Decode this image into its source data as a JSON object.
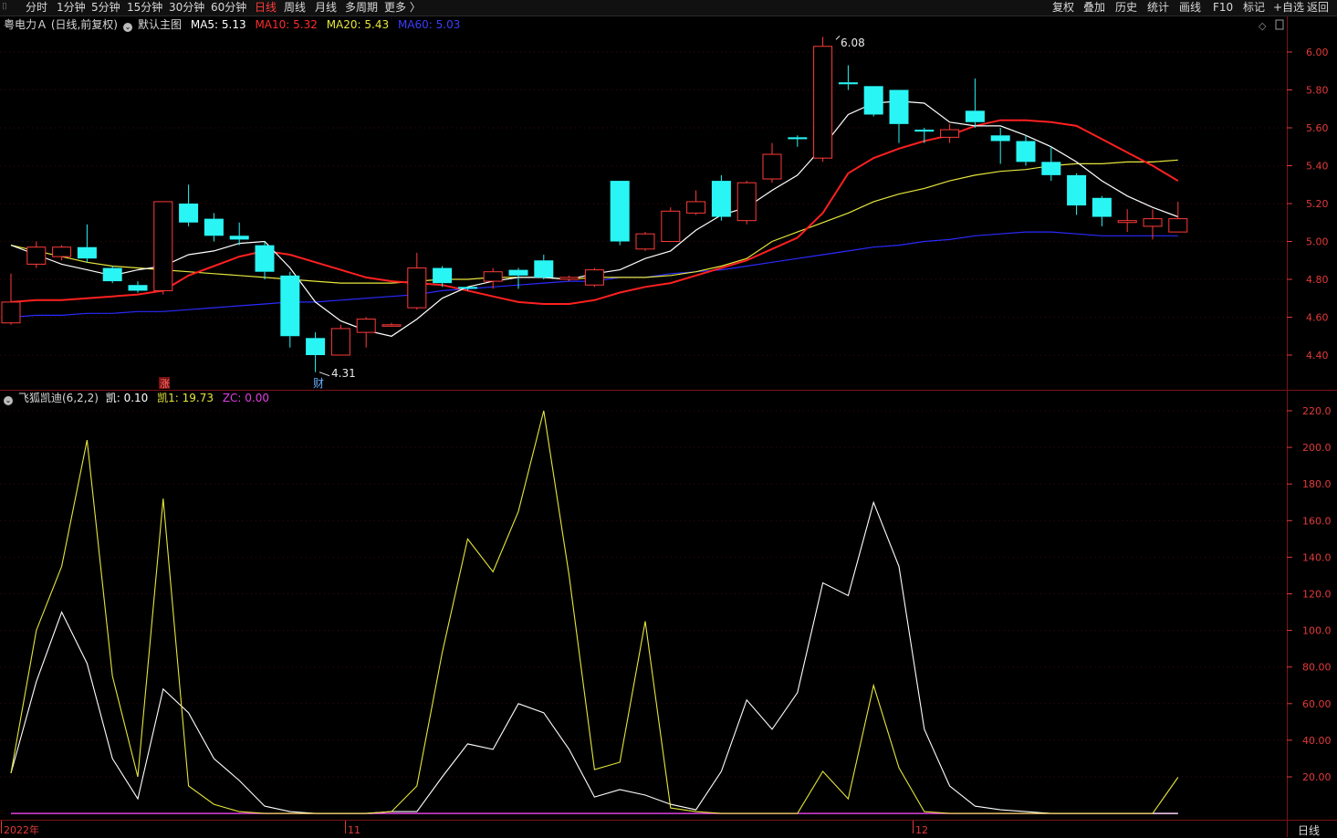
{
  "toolbar": {
    "left": [
      {
        "label": "分时",
        "active": false
      },
      {
        "label": "1分钟",
        "active": false
      },
      {
        "label": "5分钟",
        "active": false
      },
      {
        "label": "15分钟",
        "active": false
      },
      {
        "label": "30分钟",
        "active": false
      },
      {
        "label": "60分钟",
        "active": false
      },
      {
        "label": "日线",
        "active": true
      },
      {
        "label": "周线",
        "active": false
      },
      {
        "label": "月线",
        "active": false
      },
      {
        "label": "多周期",
        "active": false
      },
      {
        "label": "更多 〉",
        "active": false
      }
    ],
    "right": [
      "复权",
      "叠加",
      "历史",
      "统计",
      "画线",
      "F10",
      "标记",
      "+自选",
      "返回"
    ]
  },
  "main_legend": {
    "title": "粤电力Ａ (日线,前复权)",
    "template": "默认主图",
    "ma5": "MA5: 5.13",
    "ma10": "MA10: 5.32",
    "ma20": "MA20: 5.43",
    "ma60": "MA60: 5.03",
    "colors": {
      "ma5": "#ffffff",
      "ma10": "#ff2d2d",
      "ma20": "#e6e63c",
      "ma60": "#3232ff"
    }
  },
  "sub_legend": {
    "title": "飞狐凯迪(6,2,2)",
    "k": "凯: 0.10",
    "k1": "凯1: 19.73",
    "zc": "ZC: 0.00",
    "colors": {
      "k": "#ffffff",
      "k1": "#e6e63c",
      "zc": "#e040e0"
    }
  },
  "annotations": {
    "high": "6.08",
    "low": "4.31",
    "zhang": "涨",
    "cai": "财"
  },
  "x_labels": [
    "2022年",
    "11",
    "12"
  ],
  "footer_label": "日线",
  "chart_data": [
    {
      "type": "candlestick",
      "ylim": [
        4.23,
        6.18
      ],
      "yticks": [
        "6.00",
        "5.80",
        "5.60",
        "5.40",
        "5.20",
        "5.00",
        "4.80",
        "4.60",
        "4.40"
      ],
      "candles": [
        [
          4.57,
          4.68,
          4.56,
          4.83
        ],
        [
          4.88,
          4.97,
          4.86,
          5.0
        ],
        [
          4.92,
          4.97,
          4.9,
          4.98
        ],
        [
          4.97,
          4.91,
          4.89,
          5.09
        ],
        [
          4.86,
          4.79,
          4.78,
          4.87
        ],
        [
          4.77,
          4.74,
          4.73,
          4.79
        ],
        [
          4.74,
          5.21,
          4.72,
          5.21
        ],
        [
          5.2,
          5.1,
          5.08,
          5.3
        ],
        [
          5.12,
          5.03,
          5.0,
          5.15
        ],
        [
          5.03,
          5.01,
          4.98,
          5.1
        ],
        [
          4.98,
          4.84,
          4.8,
          5.0
        ],
        [
          4.82,
          4.5,
          4.44,
          4.84
        ],
        [
          4.49,
          4.4,
          4.31,
          4.52
        ],
        [
          4.4,
          4.54,
          4.4,
          4.56
        ],
        [
          4.52,
          4.59,
          4.44,
          4.6
        ],
        [
          4.56,
          4.56,
          4.55,
          4.57
        ],
        [
          4.65,
          4.86,
          4.64,
          4.94
        ],
        [
          4.86,
          4.78,
          4.76,
          4.87
        ],
        [
          4.76,
          4.75,
          4.74,
          4.76
        ],
        [
          4.79,
          4.84,
          4.75,
          4.86
        ],
        [
          4.85,
          4.82,
          4.75,
          4.86
        ],
        [
          4.9,
          4.81,
          4.8,
          4.93
        ],
        [
          4.8,
          4.81,
          4.79,
          4.82
        ],
        [
          4.77,
          4.85,
          4.76,
          4.86
        ],
        [
          5.32,
          5.0,
          4.98,
          5.32
        ],
        [
          4.96,
          5.04,
          4.95,
          5.05
        ],
        [
          5.0,
          5.16,
          5.0,
          5.18
        ],
        [
          5.15,
          5.21,
          5.14,
          5.27
        ],
        [
          5.32,
          5.13,
          5.11,
          5.35
        ],
        [
          5.11,
          5.31,
          5.09,
          5.32
        ],
        [
          5.33,
          5.46,
          5.31,
          5.52
        ],
        [
          5.55,
          5.54,
          5.5,
          5.56
        ],
        [
          5.44,
          6.03,
          5.42,
          6.08
        ],
        [
          5.84,
          5.83,
          5.8,
          5.93
        ],
        [
          5.82,
          5.67,
          5.66,
          5.82
        ],
        [
          5.8,
          5.62,
          5.52,
          5.8
        ],
        [
          5.59,
          5.58,
          5.52,
          5.6
        ],
        [
          5.55,
          5.59,
          5.52,
          5.62
        ],
        [
          5.69,
          5.63,
          5.6,
          5.86
        ],
        [
          5.56,
          5.53,
          5.41,
          5.6
        ],
        [
          5.53,
          5.42,
          5.4,
          5.56
        ],
        [
          5.42,
          5.35,
          5.32,
          5.5
        ],
        [
          5.35,
          5.19,
          5.14,
          5.36
        ],
        [
          5.23,
          5.13,
          5.08,
          5.24
        ],
        [
          5.1,
          5.11,
          5.05,
          5.17
        ],
        [
          5.08,
          5.12,
          5.01,
          5.17
        ],
        [
          5.05,
          5.12,
          5.05,
          5.21
        ]
      ],
      "ma5": [
        4.98,
        4.93,
        4.88,
        4.85,
        4.82,
        4.85,
        4.87,
        4.93,
        4.95,
        4.99,
        5.0,
        4.86,
        4.68,
        4.58,
        4.53,
        4.5,
        4.59,
        4.7,
        4.76,
        4.79,
        4.81,
        4.81,
        4.8,
        4.83,
        4.85,
        4.91,
        4.95,
        5.06,
        5.14,
        5.18,
        5.27,
        5.35,
        5.5,
        5.67,
        5.73,
        5.74,
        5.73,
        5.63,
        5.61,
        5.61,
        5.56,
        5.5,
        5.42,
        5.32,
        5.24,
        5.18,
        5.13
      ],
      "ma10": [
        4.68,
        4.69,
        4.69,
        4.7,
        4.71,
        4.72,
        4.74,
        4.82,
        4.87,
        4.92,
        4.95,
        4.93,
        4.89,
        4.85,
        4.81,
        4.79,
        4.78,
        4.77,
        4.74,
        4.71,
        4.68,
        4.67,
        4.67,
        4.69,
        4.73,
        4.76,
        4.78,
        4.82,
        4.86,
        4.9,
        4.96,
        5.02,
        5.15,
        5.36,
        5.44,
        5.49,
        5.53,
        5.56,
        5.61,
        5.64,
        5.64,
        5.63,
        5.61,
        5.54,
        5.47,
        5.4,
        5.32
      ],
      "ma20": [
        4.98,
        4.95,
        4.92,
        4.89,
        4.87,
        4.86,
        4.85,
        4.84,
        4.83,
        4.82,
        4.81,
        4.8,
        4.79,
        4.78,
        4.78,
        4.78,
        4.79,
        4.8,
        4.8,
        4.81,
        4.81,
        4.81,
        4.8,
        4.81,
        4.81,
        4.81,
        4.82,
        4.84,
        4.87,
        4.91,
        5.0,
        5.05,
        5.1,
        5.15,
        5.21,
        5.25,
        5.28,
        5.32,
        5.35,
        5.37,
        5.38,
        5.4,
        5.41,
        5.41,
        5.42,
        5.42,
        5.43
      ],
      "ma60": [
        4.6,
        4.61,
        4.61,
        4.62,
        4.62,
        4.63,
        4.63,
        4.64,
        4.65,
        4.66,
        4.67,
        4.68,
        4.68,
        4.69,
        4.7,
        4.71,
        4.72,
        4.74,
        4.75,
        4.76,
        4.77,
        4.78,
        4.79,
        4.79,
        4.81,
        4.81,
        4.83,
        4.84,
        4.85,
        4.87,
        4.89,
        4.91,
        4.93,
        4.95,
        4.97,
        4.98,
        5.0,
        5.01,
        5.03,
        5.04,
        5.05,
        5.05,
        5.04,
        5.03,
        5.03,
        5.03,
        5.03
      ]
    },
    {
      "type": "line",
      "ylim": [
        0,
        225
      ],
      "yticks": [
        "220.0",
        "200.0",
        "180.0",
        "160.0",
        "140.0",
        "120.0",
        "100.0",
        "80.00",
        "60.00",
        "40.00",
        "20.00"
      ],
      "series": [
        {
          "name": "凯",
          "values": [
            22,
            72,
            110,
            82,
            30,
            8,
            68,
            55,
            30,
            18,
            4,
            1,
            0,
            0,
            0,
            1,
            1,
            20,
            38,
            35,
            60,
            55,
            35,
            9,
            13,
            10,
            5,
            2,
            23,
            62,
            46,
            66,
            126,
            119,
            170,
            135,
            46,
            15,
            4,
            2,
            1,
            0,
            0,
            0,
            0,
            0,
            0
          ]
        },
        {
          "name": "凯1",
          "values": [
            22,
            100,
            135,
            204,
            75,
            20,
            172,
            15,
            5,
            1,
            0,
            0,
            0,
            0,
            0,
            1,
            15,
            88,
            150,
            132,
            165,
            220,
            130,
            24,
            28,
            105,
            3,
            1,
            0,
            0,
            0,
            0,
            23,
            8,
            70,
            25,
            1,
            0,
            0,
            0,
            0,
            0,
            0,
            0,
            0,
            0,
            19.73
          ]
        },
        {
          "name": "ZC",
          "values": [
            0,
            0,
            0,
            0,
            0,
            0,
            0,
            0,
            0,
            0,
            0,
            0,
            0,
            0,
            0,
            0,
            0,
            0,
            0,
            0,
            0,
            0,
            0,
            0,
            0,
            0,
            0,
            0,
            0,
            0,
            0,
            0,
            0,
            0,
            0,
            0,
            0,
            0,
            0,
            0,
            0,
            0,
            0,
            0,
            0,
            0,
            0
          ]
        }
      ]
    }
  ]
}
